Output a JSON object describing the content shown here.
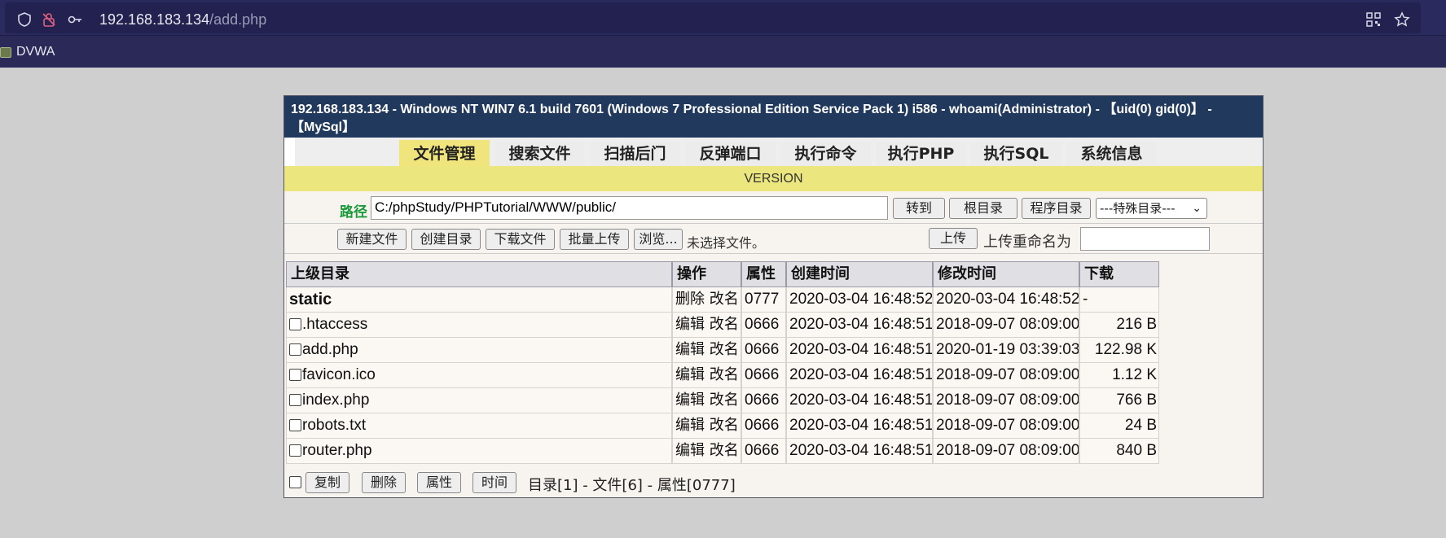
{
  "browser": {
    "url_host": "192.168.183.134",
    "url_path": "/add.php",
    "icons": [
      "shield-icon",
      "lock-slash-icon",
      "key-icon",
      "qr-code-icon",
      "star-icon"
    ],
    "bookmark": "DVWA"
  },
  "panel": {
    "header": "192.168.183.134 - Windows NT WIN7 6.1 build 7601 (Windows 7 Professional Edition Service Pack 1) i586 - whoami(Administrator) - 【uid(0) gid(0)】 - 【MySql】",
    "tabs": [
      "文件管理",
      "搜索文件",
      "扫描后门",
      "反弹端口",
      "执行命令",
      "执行PHP",
      "执行SQL",
      "系统信息"
    ],
    "active_tab": 0,
    "version": "VERSION"
  },
  "pathbar": {
    "label": "路径",
    "value": "C:/phpStudy/PHPTutorial/WWW/public/",
    "go_button": "转到",
    "root_button": "根目录",
    "program_button": "程序目录",
    "special_select": "---特殊目录---"
  },
  "actions": {
    "new_file": "新建文件",
    "new_dir": "创建目录",
    "download": "下载文件",
    "batch_upload": "批量上传",
    "browse": "浏览...",
    "no_file": "未选择文件。",
    "upload": "上传",
    "rename_label": "上传重命名为"
  },
  "table": {
    "headers": [
      "上级目录",
      "操作",
      "属性",
      "创建时间",
      "修改时间",
      "下载"
    ],
    "rows": [
      {
        "name": "static",
        "is_dir": true,
        "ops": "删除 改名",
        "perm": "0777",
        "created": "2020-03-04 16:48:52",
        "modified": "2020-03-04 16:48:52",
        "size": "-"
      },
      {
        "name": ".htaccess",
        "is_dir": false,
        "ops": "编辑 改名",
        "perm": "0666",
        "created": "2020-03-04 16:48:51",
        "modified": "2018-09-07 08:09:00",
        "size": "216 B"
      },
      {
        "name": "add.php",
        "is_dir": false,
        "ops": "编辑 改名",
        "perm": "0666",
        "created": "2020-03-04 16:48:51",
        "modified": "2020-01-19 03:39:03",
        "size": "122.98 K"
      },
      {
        "name": "favicon.ico",
        "is_dir": false,
        "ops": "编辑 改名",
        "perm": "0666",
        "created": "2020-03-04 16:48:51",
        "modified": "2018-09-07 08:09:00",
        "size": "1.12 K"
      },
      {
        "name": "index.php",
        "is_dir": false,
        "ops": "编辑 改名",
        "perm": "0666",
        "created": "2020-03-04 16:48:51",
        "modified": "2018-09-07 08:09:00",
        "size": "766 B"
      },
      {
        "name": "robots.txt",
        "is_dir": false,
        "ops": "编辑 改名",
        "perm": "0666",
        "created": "2020-03-04 16:48:51",
        "modified": "2018-09-07 08:09:00",
        "size": "24 B"
      },
      {
        "name": "router.php",
        "is_dir": false,
        "ops": "编辑 改名",
        "perm": "0666",
        "created": "2020-03-04 16:48:51",
        "modified": "2018-09-07 08:09:00",
        "size": "840 B"
      }
    ]
  },
  "footer": {
    "copy": "复制",
    "delete": "删除",
    "attr": "属性",
    "time": "时间",
    "summary": "目录[1] - 文件[6] - 属性[0777]"
  }
}
